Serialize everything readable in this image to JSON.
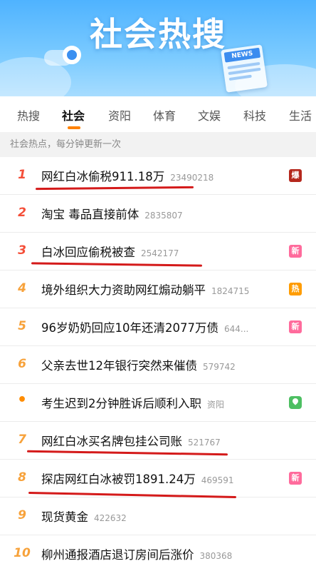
{
  "banner": {
    "title": "社会热搜"
  },
  "tabs": [
    {
      "label": "热搜",
      "active": false
    },
    {
      "label": "社会",
      "active": true
    },
    {
      "label": "资阳",
      "active": false
    },
    {
      "label": "体育",
      "active": false
    },
    {
      "label": "文娱",
      "active": false
    },
    {
      "label": "科技",
      "active": false
    },
    {
      "label": "生活",
      "active": false
    }
  ],
  "subheader": "社会热点，每分钟更新一次",
  "items": [
    {
      "rank": "1",
      "title": "网红白冰偷税911.18万",
      "count": "23490218",
      "badge": "爆"
    },
    {
      "rank": "2",
      "title": "淘宝 毒品直接前体",
      "count": "2835807",
      "badge": ""
    },
    {
      "rank": "3",
      "title": "白冰回应偷税被查",
      "count": "2542177",
      "badge": "新"
    },
    {
      "rank": "4",
      "title": "境外组织大力资助网红煽动躺平",
      "count": "1824715",
      "badge": "热"
    },
    {
      "rank": "5",
      "title": "96岁奶奶回应10年还清2077万债",
      "count": "644...",
      "badge": "新"
    },
    {
      "rank": "6",
      "title": "父亲去世12年银行突然来催债",
      "count": "579742",
      "badge": ""
    },
    {
      "rank": "•",
      "title": "考生迟到2分钟胜诉后顺利入职",
      "location": "资阳",
      "badge": "location"
    },
    {
      "rank": "7",
      "title": "网红白冰买名牌包挂公司账",
      "count": "521767",
      "badge": ""
    },
    {
      "rank": "8",
      "title": "探店网红白冰被罚1891.24万",
      "count": "469591",
      "badge": "新"
    },
    {
      "rank": "9",
      "title": "现货黄金",
      "count": "422632",
      "badge": ""
    },
    {
      "rank": "10",
      "title": "柳州通报酒店退订房间后涨价",
      "count": "380368",
      "badge": ""
    }
  ],
  "colors": {
    "accent_tab": "#ff8200",
    "rank_top": "#f44e38",
    "rank_other": "#f7a23b",
    "badge_bao": "#b5281d",
    "badge_xin": "#ff6b9c",
    "badge_re": "#ff9c00",
    "badge_location": "#4dbf62",
    "marker": "#d41a1a"
  }
}
